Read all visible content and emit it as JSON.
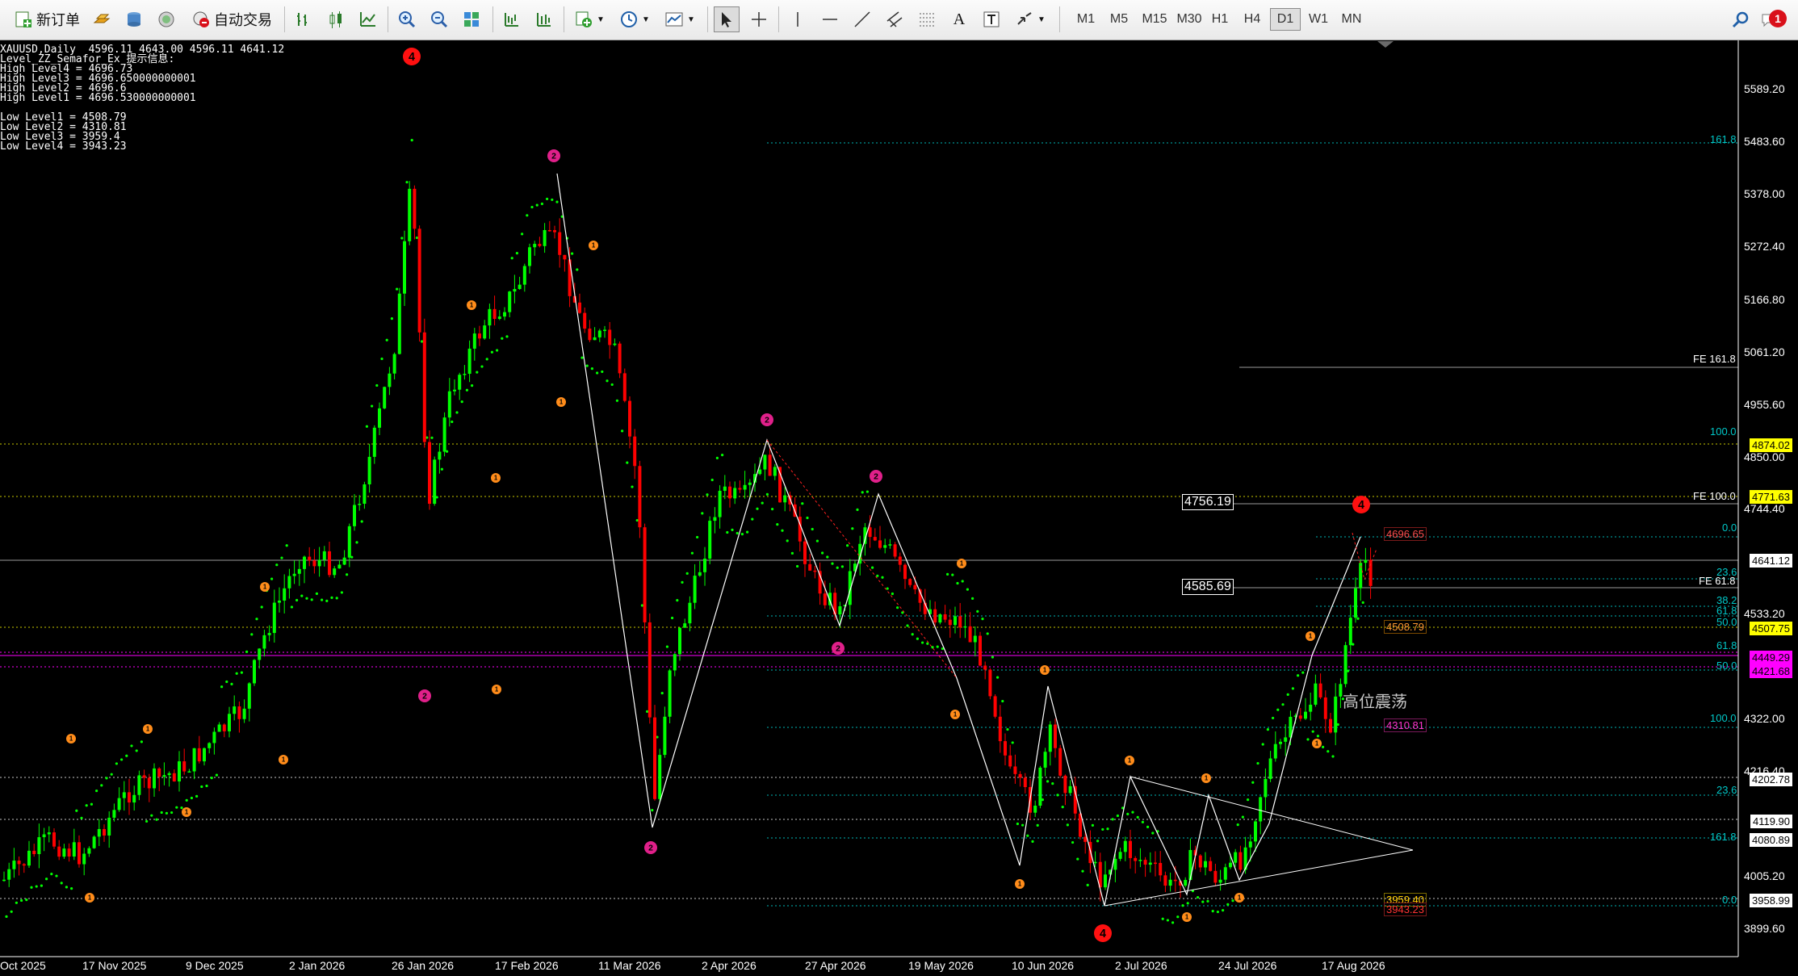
{
  "toolbar": {
    "new_order": "新订单",
    "auto_trading": "自动交易",
    "timeframes": [
      "M1",
      "M5",
      "M15",
      "M30",
      "H1",
      "H4",
      "D1",
      "W1",
      "MN"
    ],
    "active_timeframe": "D1",
    "notification_count": "1"
  },
  "chart": {
    "header": "XAUUSD,Daily  4596.11 4643.00 4596.11 4641.12",
    "indicator_title": "Level_ZZ_Semafor_Ex 提示信息:",
    "high_levels": [
      "High Level4 = 4696.73",
      "High Level3 = 4696.650000000001",
      "High Level2 = 4696.6",
      "High Level1 = 4696.530000000001"
    ],
    "low_levels": [
      "Low Level1 = 4508.79",
      "Low Level2 = 4310.81",
      "Low Level3 = 3959.4",
      "Low Level4 = 3943.23"
    ],
    "annotation": "高位震荡",
    "current_price": "4641.12",
    "boxed_prices": [
      "4756.19",
      "4585.69"
    ],
    "price_axis": [
      "5589.20",
      "5483.60",
      "5378.00",
      "5272.40",
      "5166.80",
      "5061.20",
      "4955.60",
      "4850.00",
      "4744.40",
      "4533.20",
      "4322.00",
      "4216.40",
      "4005.20",
      "3899.60"
    ],
    "price_tags": [
      {
        "text": "4874.02",
        "bg": "#ffff00"
      },
      {
        "text": "4771.63",
        "bg": "#ffff00"
      },
      {
        "text": "4641.12",
        "bg": "#ffffff"
      },
      {
        "text": "4507.75",
        "bg": "#ffff00"
      },
      {
        "text": "4449.29",
        "bg": "#ff00ff"
      },
      {
        "text": "4421.68",
        "bg": "#ff00ff"
      },
      {
        "text": "4202.78",
        "bg": "#ffffff"
      },
      {
        "text": "4119.90",
        "bg": "#ffffff"
      },
      {
        "text": "4080.89",
        "bg": "#ffffff"
      },
      {
        "text": "3958.99",
        "bg": "#ffffff"
      }
    ],
    "fib_labels_cyan": [
      "161.8",
      "100.0",
      "0.0",
      "23.6",
      "38.2",
      "61.8",
      "50.0",
      "61.8",
      "50.0",
      "100.0",
      "23.6",
      "161.8",
      "0.0"
    ],
    "fe_labels": [
      "FE 161.8",
      "FE 100.0",
      "FE 61.8"
    ],
    "level_boxes": [
      {
        "text": "4696.65",
        "color": "#ff4d4d"
      },
      {
        "text": "4508.79",
        "color": "#ff9933"
      },
      {
        "text": "4310.81",
        "color": "#ff33cc"
      },
      {
        "text": "3959.40",
        "color": "#ffcc00"
      },
      {
        "text": "3943.23",
        "color": "#ff3333"
      }
    ],
    "date_axis": [
      "Oct 2025",
      "17 Nov 2025",
      "9 Dec 2025",
      "2 Jan 2026",
      "26 Jan 2026",
      "17 Feb 2026",
      "11 Mar 2026",
      "2 Apr 2026",
      "27 Apr 2026",
      "19 May 2026",
      "10 Jun 2026",
      "2 Jul 2026",
      "24 Jul 2026",
      "17 Aug 2026"
    ],
    "colors": {
      "bull": "#00ff00",
      "bear": "#ff0000",
      "psar": "#00ff00",
      "background": "#000000"
    }
  }
}
